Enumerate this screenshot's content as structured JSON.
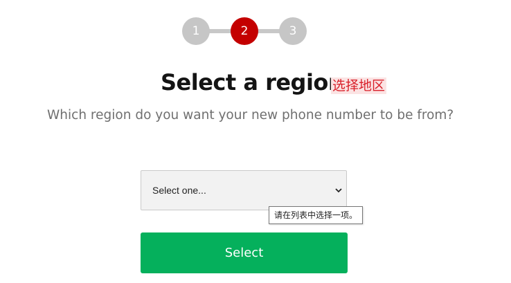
{
  "stepper": {
    "steps": [
      "1",
      "2",
      "3"
    ],
    "active_step": "2",
    "active_color": "#c40000",
    "inactive_color": "#c6c6c6"
  },
  "header": {
    "title": "Select a region",
    "title_annotation": "选择地区",
    "subtitle": "Which region do you want your new phone number to be from?"
  },
  "form": {
    "region_select": {
      "selected": "Select one...",
      "icon": "chevron-down-icon"
    },
    "validation_tooltip": "请在列表中选择一项。",
    "submit_label": "Select",
    "submit_color": "#05b05c"
  }
}
